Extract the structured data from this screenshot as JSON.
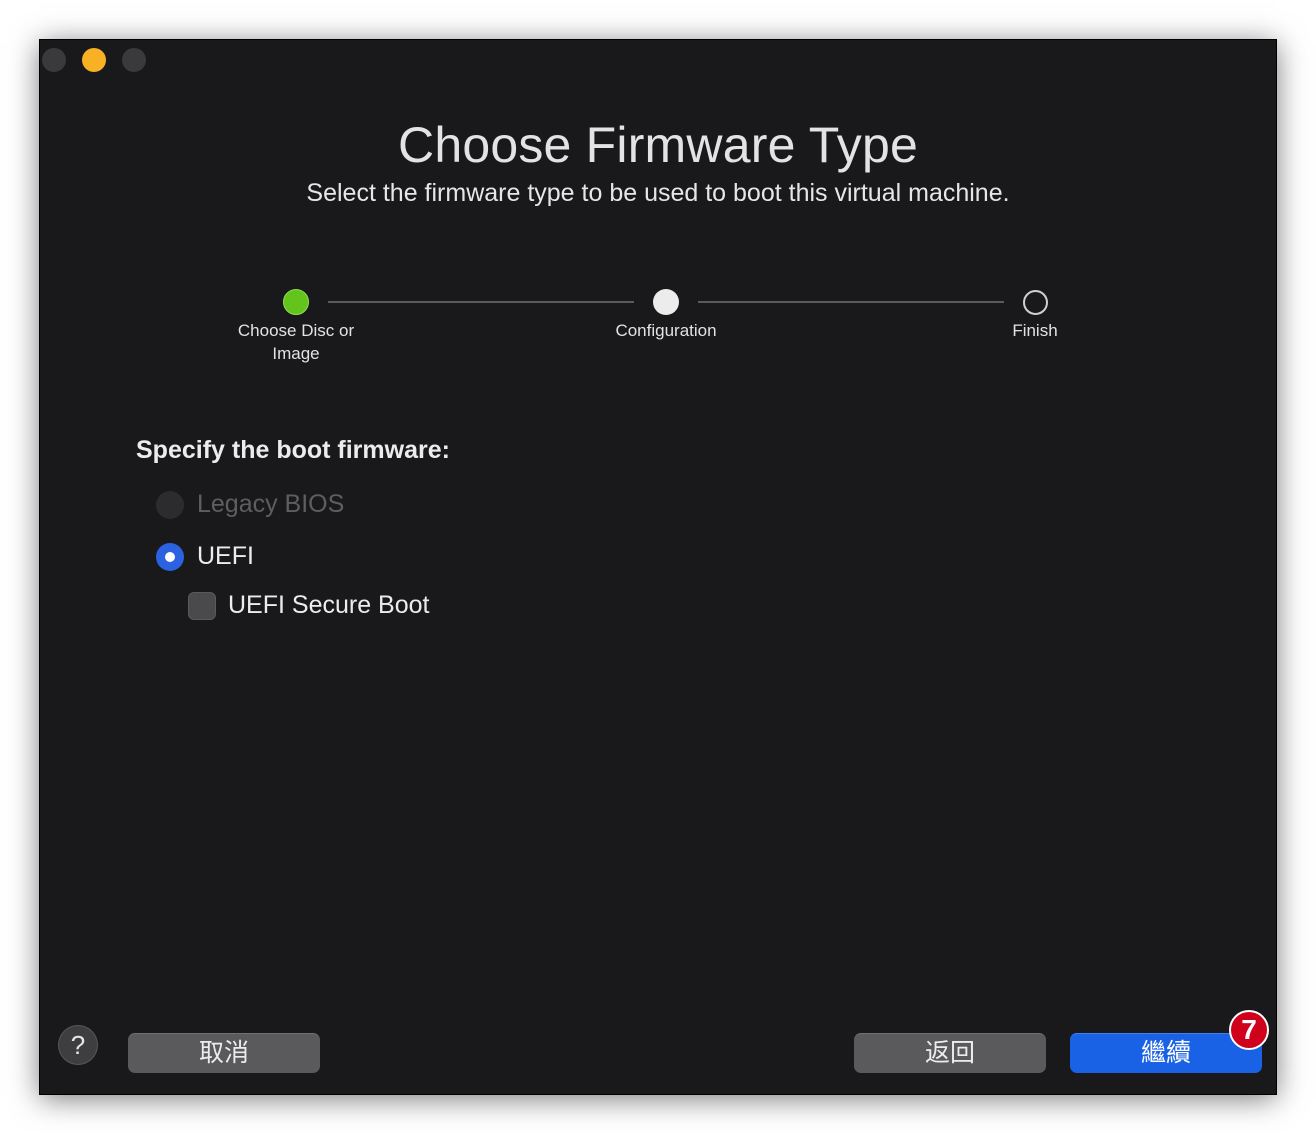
{
  "window": {
    "title": "Choose Firmware Type",
    "subtitle": "Select the firmware type to be used to boot this virtual machine."
  },
  "stepper": {
    "steps": [
      {
        "label": "Choose Disc or Image",
        "state": "completed",
        "color": "#62c41d"
      },
      {
        "label": "Configuration",
        "state": "current",
        "color": "#ececec"
      },
      {
        "label": "Finish",
        "state": "pending",
        "color": "#d0d0d0"
      }
    ]
  },
  "firmware": {
    "section_label": "Specify the boot firmware:",
    "options": [
      {
        "label": "Legacy BIOS",
        "selected": false,
        "disabled": true
      },
      {
        "label": "UEFI",
        "selected": true,
        "disabled": false
      }
    ],
    "secure_boot": {
      "label": "UEFI Secure Boot",
      "checked": false
    }
  },
  "footer": {
    "help_label": "?",
    "cancel_label": "取消",
    "back_label": "返回",
    "continue_label": "繼續",
    "badge_number": "7"
  },
  "colors": {
    "accent": "#1a62e5",
    "badge": "#d0021b",
    "window_bg": "#19191b"
  }
}
